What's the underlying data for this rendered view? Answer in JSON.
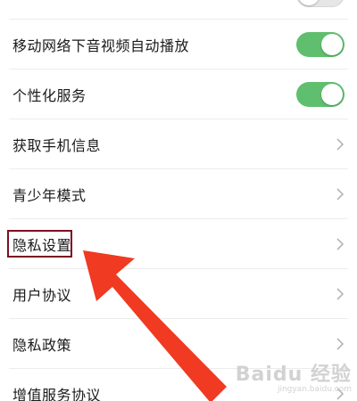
{
  "settings": {
    "items": [
      {
        "label": "移动网络下音视频自动播放",
        "control": "toggle",
        "on": true
      },
      {
        "label": "个性化服务",
        "control": "toggle",
        "on": true
      },
      {
        "label": "获取手机信息",
        "control": "chevron"
      },
      {
        "label": "青少年模式",
        "control": "chevron"
      },
      {
        "label": "隐私设置",
        "control": "chevron",
        "highlighted": true
      },
      {
        "label": "用户协议",
        "control": "chevron"
      },
      {
        "label": "隐私政策",
        "control": "chevron"
      },
      {
        "label": "增值服务协议",
        "control": "chevron"
      }
    ]
  },
  "colors": {
    "toggle_on": "#5fbf6e",
    "highlight_border": "#7a1020",
    "arrow": "#f03a22"
  },
  "watermark": {
    "brand": "Baidu 经验",
    "url": "jingyan.baidu.com"
  }
}
